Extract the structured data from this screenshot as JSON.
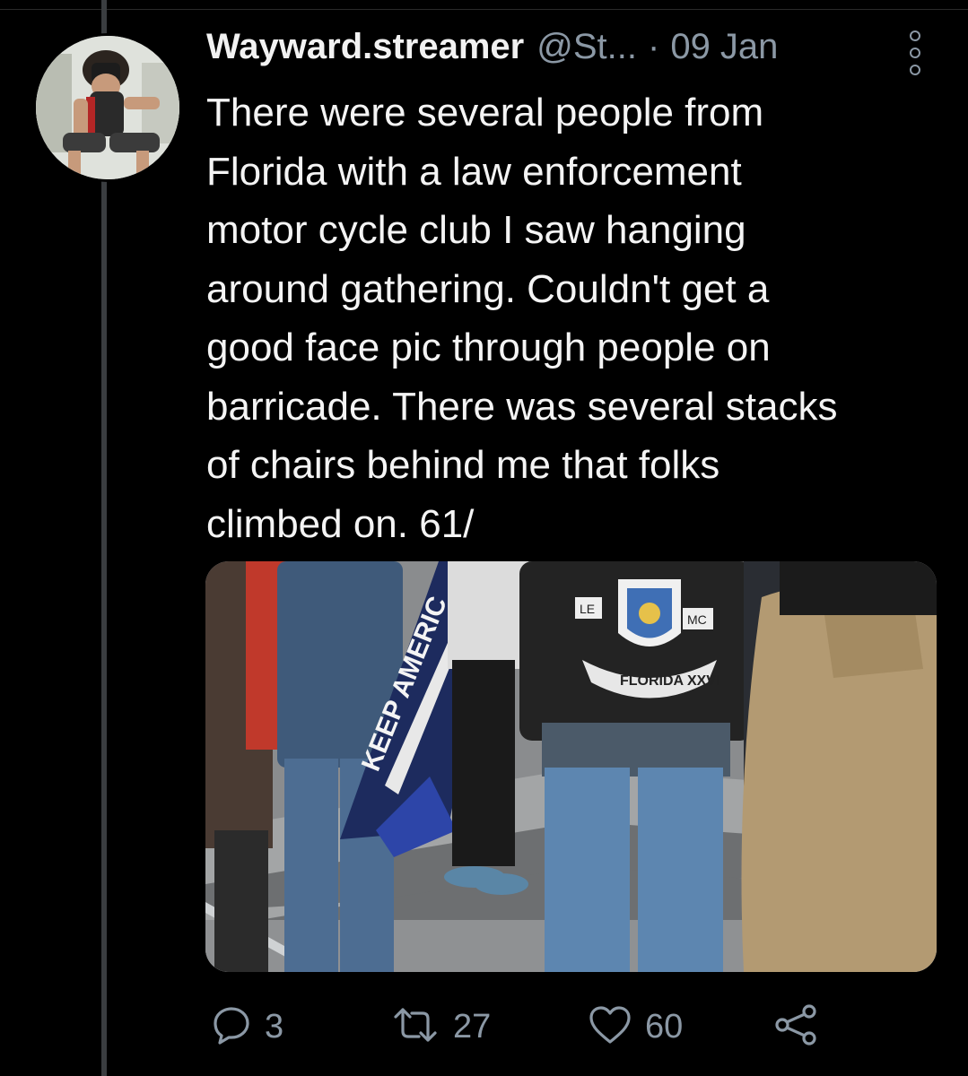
{
  "tweet": {
    "author_name": "Wayward.streamer",
    "author_handle": "@St...",
    "separator": "·",
    "date": "09 Jan",
    "text": "There were several people from\nFlorida with a law enforcement\nmotor cycle club I saw hanging\naround gathering. Couldn't get a\ngood face pic through people on\nbarricade. There was several stacks\nof chairs behind me that folks\nclimbed on. 61/",
    "media": {
      "banner_text": "KEEP AMERIC",
      "patch_text": "FLORIDA XXVI",
      "patch_letters_left": "LE",
      "patch_letters_right": "MC"
    },
    "actions": {
      "reply_count": "3",
      "retweet_count": "27",
      "like_count": "60"
    }
  },
  "icons": {
    "reply": "reply-icon",
    "retweet": "retweet-icon",
    "like": "heart-icon",
    "share": "share-icon",
    "more": "more-icon"
  },
  "colors": {
    "background": "#000000",
    "secondary_text": "#8b98a5",
    "thread_line": "#3a3d40"
  }
}
